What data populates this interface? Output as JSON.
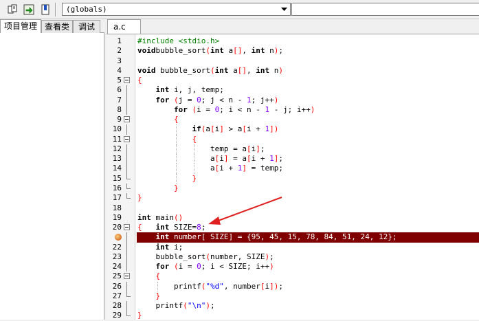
{
  "toolbar": {
    "icons": [
      "document-icon",
      "green-arrow-icon",
      "bookmark-icon"
    ],
    "globals_value": "(globals)",
    "second_value": ""
  },
  "left_panel": {
    "tabs": [
      {
        "label": "项目管理",
        "active": true
      },
      {
        "label": "查看类",
        "active": false
      },
      {
        "label": "调试",
        "active": false
      }
    ]
  },
  "editor": {
    "tab_label": "a.c",
    "highlight_line": 21,
    "breakpoint_line": 21,
    "colors": {
      "highlight": "#800000",
      "keyword": "#000000",
      "preprocessor": "#008000",
      "bracket": "#ff0000",
      "number": "#8000ff",
      "string": "#0000ff"
    },
    "lines": [
      {
        "n": "1",
        "fold": "",
        "guides": [],
        "tokens": [
          [
            "pp",
            "#include <stdio.h>"
          ]
        ]
      },
      {
        "n": "2",
        "fold": "",
        "guides": [],
        "tokens": [
          [
            "kw",
            "void"
          ],
          [
            "",
            "bubble_sort"
          ],
          [
            "br",
            "("
          ],
          [
            "kw",
            "int"
          ],
          [
            "",
            " a"
          ],
          [
            "br",
            "[]"
          ],
          [
            "",
            ", "
          ],
          [
            "kw",
            "int"
          ],
          [
            "",
            " n"
          ],
          [
            "br",
            ")"
          ],
          [
            "",
            ";"
          ]
        ]
      },
      {
        "n": "3",
        "fold": "",
        "guides": [],
        "tokens": []
      },
      {
        "n": "4",
        "fold": "",
        "guides": [],
        "tokens": [
          [
            "kw",
            "void"
          ],
          [
            "",
            " bubble_sort"
          ],
          [
            "br",
            "("
          ],
          [
            "kw",
            "int"
          ],
          [
            "",
            " a"
          ],
          [
            "br",
            "[]"
          ],
          [
            "",
            ", "
          ],
          [
            "kw",
            "int"
          ],
          [
            "",
            " n"
          ],
          [
            "br",
            ")"
          ]
        ]
      },
      {
        "n": "5",
        "fold": "open",
        "guides": [],
        "tokens": [
          [
            "br",
            "{"
          ]
        ]
      },
      {
        "n": "6",
        "fold": "line",
        "guides": [],
        "tokens": [
          [
            "",
            "    "
          ],
          [
            "kw",
            "int"
          ],
          [
            "",
            " i, j, temp;"
          ]
        ]
      },
      {
        "n": "7",
        "fold": "line",
        "guides": [],
        "tokens": [
          [
            "",
            "    "
          ],
          [
            "kw",
            "for"
          ],
          [
            "",
            " "
          ],
          [
            "br",
            "("
          ],
          [
            "",
            "j = "
          ],
          [
            "num",
            "0"
          ],
          [
            "",
            "; j < n - "
          ],
          [
            "num",
            "1"
          ],
          [
            "",
            "; j++"
          ],
          [
            "br",
            ")"
          ]
        ]
      },
      {
        "n": "8",
        "fold": "line",
        "guides": [],
        "tokens": [
          [
            "",
            "        "
          ],
          [
            "kw",
            "for"
          ],
          [
            "",
            " "
          ],
          [
            "br",
            "("
          ],
          [
            "",
            "i = "
          ],
          [
            "num",
            "0"
          ],
          [
            "",
            "; i < n - "
          ],
          [
            "num",
            "1"
          ],
          [
            "",
            " - j; i++"
          ],
          [
            "br",
            ")"
          ]
        ]
      },
      {
        "n": "9",
        "fold": "open",
        "guides": [],
        "tokens": [
          [
            "",
            "        "
          ],
          [
            "br",
            "{"
          ]
        ]
      },
      {
        "n": "10",
        "fold": "line",
        "guides": [
          8
        ],
        "tokens": [
          [
            "",
            "            "
          ],
          [
            "kw",
            "if"
          ],
          [
            "br",
            "("
          ],
          [
            "",
            "a"
          ],
          [
            "br",
            "["
          ],
          [
            "",
            "i"
          ],
          [
            "br",
            "]"
          ],
          [
            "",
            " > a"
          ],
          [
            "br",
            "["
          ],
          [
            "",
            "i + "
          ],
          [
            "num",
            "1"
          ],
          [
            "br",
            "])"
          ]
        ]
      },
      {
        "n": "11",
        "fold": "open",
        "guides": [
          8
        ],
        "tokens": [
          [
            "",
            "            "
          ],
          [
            "br",
            "{"
          ]
        ]
      },
      {
        "n": "12",
        "fold": "line",
        "guides": [
          8,
          12
        ],
        "tokens": [
          [
            "",
            "                temp = a"
          ],
          [
            "br",
            "["
          ],
          [
            "",
            "i"
          ],
          [
            "br",
            "]"
          ],
          [
            "",
            ";"
          ]
        ]
      },
      {
        "n": "13",
        "fold": "line",
        "guides": [
          8,
          12
        ],
        "tokens": [
          [
            "",
            "                a"
          ],
          [
            "br",
            "["
          ],
          [
            "",
            "i"
          ],
          [
            "br",
            "]"
          ],
          [
            "",
            " = a"
          ],
          [
            "br",
            "["
          ],
          [
            "",
            "i + "
          ],
          [
            "num",
            "1"
          ],
          [
            "br",
            "]"
          ],
          [
            "",
            ";"
          ]
        ]
      },
      {
        "n": "14",
        "fold": "line",
        "guides": [
          8,
          12
        ],
        "tokens": [
          [
            "",
            "                a"
          ],
          [
            "br",
            "["
          ],
          [
            "",
            "i + "
          ],
          [
            "num",
            "1"
          ],
          [
            "br",
            "]"
          ],
          [
            "",
            " = temp;"
          ]
        ]
      },
      {
        "n": "15",
        "fold": "end",
        "guides": [
          8
        ],
        "tokens": [
          [
            "",
            "            "
          ],
          [
            "br",
            "}"
          ]
        ]
      },
      {
        "n": "16",
        "fold": "end",
        "guides": [],
        "tokens": [
          [
            "",
            "        "
          ],
          [
            "br",
            "}"
          ]
        ]
      },
      {
        "n": "17",
        "fold": "end",
        "guides": [],
        "tokens": [
          [
            "br",
            "}"
          ]
        ]
      },
      {
        "n": "18",
        "fold": "",
        "guides": [],
        "tokens": []
      },
      {
        "n": "19",
        "fold": "",
        "guides": [],
        "tokens": [
          [
            "kw",
            "int"
          ],
          [
            "",
            " main"
          ],
          [
            "br",
            "()"
          ]
        ]
      },
      {
        "n": "20",
        "fold": "open",
        "guides": [],
        "tokens": [
          [
            "br",
            "{"
          ],
          [
            "",
            "   "
          ],
          [
            "kw",
            "int"
          ],
          [
            "",
            " SIZE="
          ],
          [
            "num",
            "8"
          ],
          [
            "",
            ";"
          ]
        ]
      },
      {
        "n": "21",
        "fold": "line",
        "guides": [],
        "tokens": [
          [
            "",
            "    "
          ],
          [
            "kw",
            "int"
          ],
          [
            "",
            " number"
          ],
          [
            "br",
            "["
          ],
          [
            "",
            " SIZE"
          ],
          [
            "br",
            "]"
          ],
          [
            "",
            " = {95, 45, 15, 78, 84, 51, 24, 12};"
          ]
        ]
      },
      {
        "n": "22",
        "fold": "line",
        "guides": [],
        "tokens": [
          [
            "",
            "    "
          ],
          [
            "kw",
            "int"
          ],
          [
            "",
            " i;"
          ]
        ]
      },
      {
        "n": "23",
        "fold": "line",
        "guides": [],
        "tokens": [
          [
            "",
            "    bubble_sort"
          ],
          [
            "br",
            "("
          ],
          [
            "",
            "number, SIZE"
          ],
          [
            "br",
            ")"
          ],
          [
            "",
            ";"
          ]
        ]
      },
      {
        "n": "24",
        "fold": "line",
        "guides": [],
        "tokens": [
          [
            "",
            "    "
          ],
          [
            "kw",
            "for"
          ],
          [
            "",
            " "
          ],
          [
            "br",
            "("
          ],
          [
            "",
            "i = "
          ],
          [
            "num",
            "0"
          ],
          [
            "",
            "; i < SIZE; i++"
          ],
          [
            "br",
            ")"
          ]
        ]
      },
      {
        "n": "25",
        "fold": "open",
        "guides": [],
        "tokens": [
          [
            "",
            "    "
          ],
          [
            "br",
            "{"
          ]
        ]
      },
      {
        "n": "26",
        "fold": "line",
        "guides": [
          4
        ],
        "tokens": [
          [
            "",
            "        printf"
          ],
          [
            "br",
            "("
          ],
          [
            "str",
            "\"%d\""
          ],
          [
            "",
            ", number"
          ],
          [
            "br",
            "["
          ],
          [
            "",
            "i"
          ],
          [
            "br",
            "])"
          ],
          [
            "",
            ";"
          ]
        ]
      },
      {
        "n": "27",
        "fold": "end",
        "guides": [],
        "tokens": [
          [
            "",
            "    "
          ],
          [
            "br",
            "}"
          ]
        ]
      },
      {
        "n": "28",
        "fold": "line",
        "guides": [],
        "tokens": [
          [
            "",
            "    printf"
          ],
          [
            "br",
            "("
          ],
          [
            "str",
            "\"\\n\""
          ],
          [
            "br",
            ")"
          ],
          [
            "",
            ";"
          ]
        ]
      },
      {
        "n": "29",
        "fold": "end",
        "guides": [],
        "tokens": [
          [
            "br",
            "}"
          ]
        ]
      }
    ]
  },
  "annotation": {
    "type": "red-arrow",
    "color": "#e02020"
  }
}
